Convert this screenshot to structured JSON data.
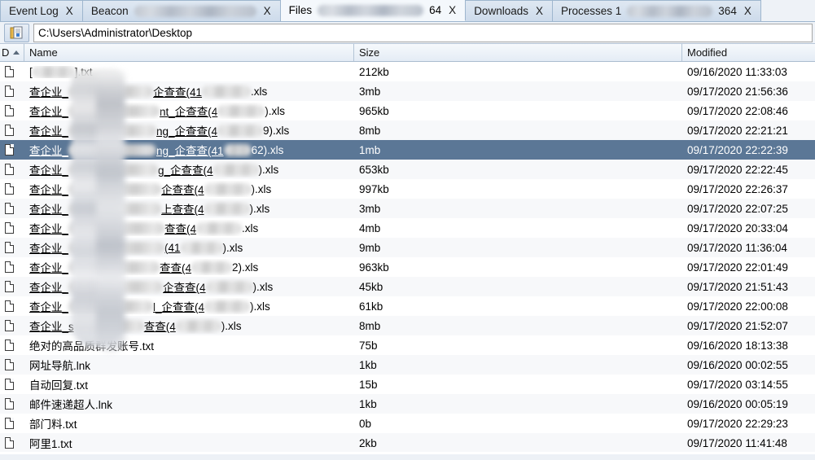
{
  "window": {
    "title": "Files"
  },
  "tabs": [
    {
      "label": "Event Log",
      "close": "X",
      "active": false,
      "redacted": false,
      "suffix": ""
    },
    {
      "label": "Beacon",
      "close": "X",
      "active": false,
      "redacted": true,
      "redact_width": 150,
      "suffix": ""
    },
    {
      "label": "Files",
      "close": "X",
      "active": true,
      "redacted": true,
      "redact_width": 130,
      "suffix": "64"
    },
    {
      "label": "Downloads",
      "close": "X",
      "active": false,
      "redacted": false,
      "suffix": ""
    },
    {
      "label": "Processes 1",
      "close": "X",
      "active": false,
      "redacted": true,
      "redact_width": 105,
      "suffix": "364"
    }
  ],
  "pathbar": {
    "icon": "folder-document-icon",
    "value": "C:\\Users\\Administrator\\Desktop",
    "placeholder": ""
  },
  "table": {
    "columns": [
      {
        "key": "d",
        "label": "D",
        "sorted": true,
        "sort_dir": "asc"
      },
      {
        "key": "name",
        "label": "Name"
      },
      {
        "key": "size",
        "label": "Size"
      },
      {
        "key": "modified",
        "label": "Modified"
      }
    ],
    "rows": [
      {
        "icon": "file-icon",
        "name_prefix": "[",
        "blur": 52,
        "name_suffix": "].txt",
        "link": false,
        "size": "212kb",
        "modified": "09/16/2020 11:33:03",
        "selected": false
      },
      {
        "icon": "file-icon",
        "name_prefix": "查企业_",
        "blur": 104,
        "name_suffix": "企查查(41",
        "blur2": 60,
        "name_suffix2": ".xls",
        "link": true,
        "size": "3mb",
        "modified": "09/17/2020 21:56:36",
        "selected": false
      },
      {
        "icon": "file-icon",
        "name_prefix": "查企业_",
        "blur": 112,
        "name_suffix": "nt_企查查(4",
        "blur2": 58,
        "name_suffix2": ").xls",
        "link": true,
        "size": "965kb",
        "modified": "09/17/2020 22:08:46",
        "selected": false
      },
      {
        "icon": "file-icon",
        "name_prefix": "查企业_",
        "blur": 108,
        "name_suffix": "ng_企查查(4",
        "blur2": 56,
        "name_suffix2": "9).xls",
        "link": true,
        "size": "8mb",
        "modified": "09/17/2020 22:21:21",
        "selected": false
      },
      {
        "icon": "file-icon",
        "name_prefix": "查企业_",
        "blur": 108,
        "name_suffix": "ng_企查查(41",
        "blur2": 34,
        "name_suffix2": "62).xls",
        "link": true,
        "size": "1mb",
        "modified": "09/17/2020 22:22:39",
        "selected": true
      },
      {
        "icon": "file-icon",
        "name_prefix": "查企业_",
        "blur": 110,
        "name_suffix": "g_企查查(4",
        "blur2": 56,
        "name_suffix2": ").xls",
        "link": true,
        "size": "653kb",
        "modified": "09/17/2020 22:22:45",
        "selected": false
      },
      {
        "icon": "file-icon",
        "name_prefix": "查企业_",
        "blur": 114,
        "name_suffix": "企查查(4",
        "blur2": 58,
        "name_suffix2": ").xls",
        "link": true,
        "size": "997kb",
        "modified": "09/17/2020 22:26:37",
        "selected": false
      },
      {
        "icon": "file-icon",
        "name_prefix": "查企业_",
        "blur": 114,
        "name_suffix": "上查查(4",
        "blur2": 56,
        "name_suffix2": ").xls",
        "link": true,
        "size": "3mb",
        "modified": "09/17/2020 22:07:25",
        "selected": false
      },
      {
        "icon": "file-icon",
        "name_prefix": "查企业_",
        "blur": 118,
        "name_suffix": "查查(4",
        "blur2": 56,
        "name_suffix2": ".xls",
        "link": true,
        "size": "4mb",
        "modified": "09/17/2020 20:33:04",
        "selected": false
      },
      {
        "icon": "file-icon",
        "name_prefix": "查企业_",
        "blur": 118,
        "name_suffix": "(41",
        "blur2": 52,
        "name_suffix2": ").xls",
        "link": true,
        "size": "9mb",
        "modified": "09/17/2020 11:36:04",
        "selected": false
      },
      {
        "icon": "file-icon",
        "name_prefix": "查企业_",
        "blur": 112,
        "name_suffix": "查查(4",
        "blur2": 50,
        "name_suffix2": "2).xls",
        "link": true,
        "size": "963kb",
        "modified": "09/17/2020 22:01:49",
        "selected": false
      },
      {
        "icon": "file-icon",
        "name_prefix": "查企业_",
        "blur": 116,
        "name_suffix": "企查查(4",
        "blur2": 58,
        "name_suffix2": ").xls",
        "link": true,
        "size": "45kb",
        "modified": "09/17/2020 21:51:43",
        "selected": false
      },
      {
        "icon": "file-icon",
        "name_prefix": "查企业_",
        "blur": 104,
        "name_suffix": "l_企查查(4",
        "blur2": 56,
        "name_suffix2": ").xls",
        "link": true,
        "size": "61kb",
        "modified": "09/17/2020 22:00:08",
        "selected": false
      },
      {
        "icon": "file-icon",
        "name_prefix": "查企业_s",
        "blur": 86,
        "name_suffix": "查查(4",
        "blur2": 56,
        "name_suffix2": ").xls",
        "link": true,
        "size": "8mb",
        "modified": "09/17/2020 21:52:07",
        "selected": false
      },
      {
        "icon": "file-icon",
        "name_prefix": "绝对的高品质群发账号.txt",
        "blur": 0,
        "name_suffix": "",
        "link": false,
        "size": "75b",
        "modified": "09/16/2020 18:13:38",
        "selected": false
      },
      {
        "icon": "file-icon",
        "name_prefix": "网址导航.lnk",
        "blur": 0,
        "name_suffix": "",
        "link": false,
        "size": "1kb",
        "modified": "09/16/2020 00:02:55",
        "selected": false
      },
      {
        "icon": "file-icon",
        "name_prefix": "自动回复.txt",
        "blur": 0,
        "name_suffix": "",
        "link": false,
        "size": "15b",
        "modified": "09/17/2020 03:14:55",
        "selected": false
      },
      {
        "icon": "file-icon",
        "name_prefix": "邮件速递超人.lnk",
        "blur": 0,
        "name_suffix": "",
        "link": false,
        "size": "1kb",
        "modified": "09/16/2020 00:05:19",
        "selected": false
      },
      {
        "icon": "file-icon",
        "name_prefix": "部门料.txt",
        "blur": 0,
        "name_suffix": "",
        "link": false,
        "size": "0b",
        "modified": "09/17/2020 22:29:23",
        "selected": false
      },
      {
        "icon": "file-icon",
        "name_prefix": "阿里1.txt",
        "blur": 0,
        "name_suffix": "",
        "link": false,
        "size": "2kb",
        "modified": "09/17/2020 11:41:48",
        "selected": false
      }
    ]
  },
  "colors": {
    "selection": "#5b7796",
    "tab_active_bg": "#f4f8fc",
    "tab_inactive_bg": "#cddbeb",
    "header_border": "#9eb6ce",
    "row_alt": "#f7f8fa"
  }
}
